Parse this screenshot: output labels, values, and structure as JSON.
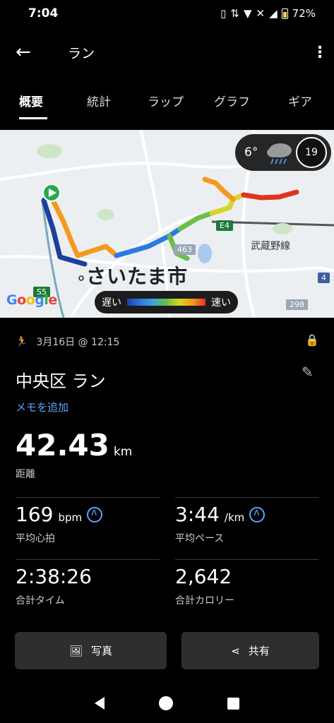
{
  "status_bar": {
    "time": "7:04",
    "battery": "72%"
  },
  "app_bar": {
    "title": "ラン"
  },
  "tabs": [
    {
      "label": "概要",
      "active": true
    },
    {
      "label": "統計"
    },
    {
      "label": "ラップ"
    },
    {
      "label": "グラフ"
    },
    {
      "label": "ギア"
    }
  ],
  "map": {
    "weather_temp": "6°",
    "lap_count": "19",
    "city_label": "さいたま市",
    "rail_line_label": "武蔵野線",
    "route_badges": {
      "e4": "E4",
      "r463": "463",
      "s5": "S5",
      "r4": "4",
      "r298": "298"
    },
    "legend": {
      "slow_label": "遅い",
      "fast_label": "速い"
    },
    "provider_logo": "Google",
    "colors": {
      "slow": "#1d3f9e",
      "mid": "#6abf45",
      "fast": "#e2331b"
    }
  },
  "activity": {
    "date_time": "3月16日 @ 12:15",
    "title": "中央区 ラン",
    "add_note": "メモを追加",
    "distance": {
      "value": "42.43",
      "unit": "km",
      "label": "距離"
    },
    "avg_hr": {
      "value": "169",
      "unit": "bpm",
      "label": "平均心拍"
    },
    "avg_pace": {
      "value": "3:44",
      "unit": "/km",
      "label": "平均ペース"
    },
    "total_time": {
      "value": "2:38:26",
      "label": "合計タイム"
    },
    "total_calories": {
      "value": "2,642",
      "label": "合計カロリー"
    }
  },
  "buttons": {
    "photo": "写真",
    "share": "共有"
  }
}
